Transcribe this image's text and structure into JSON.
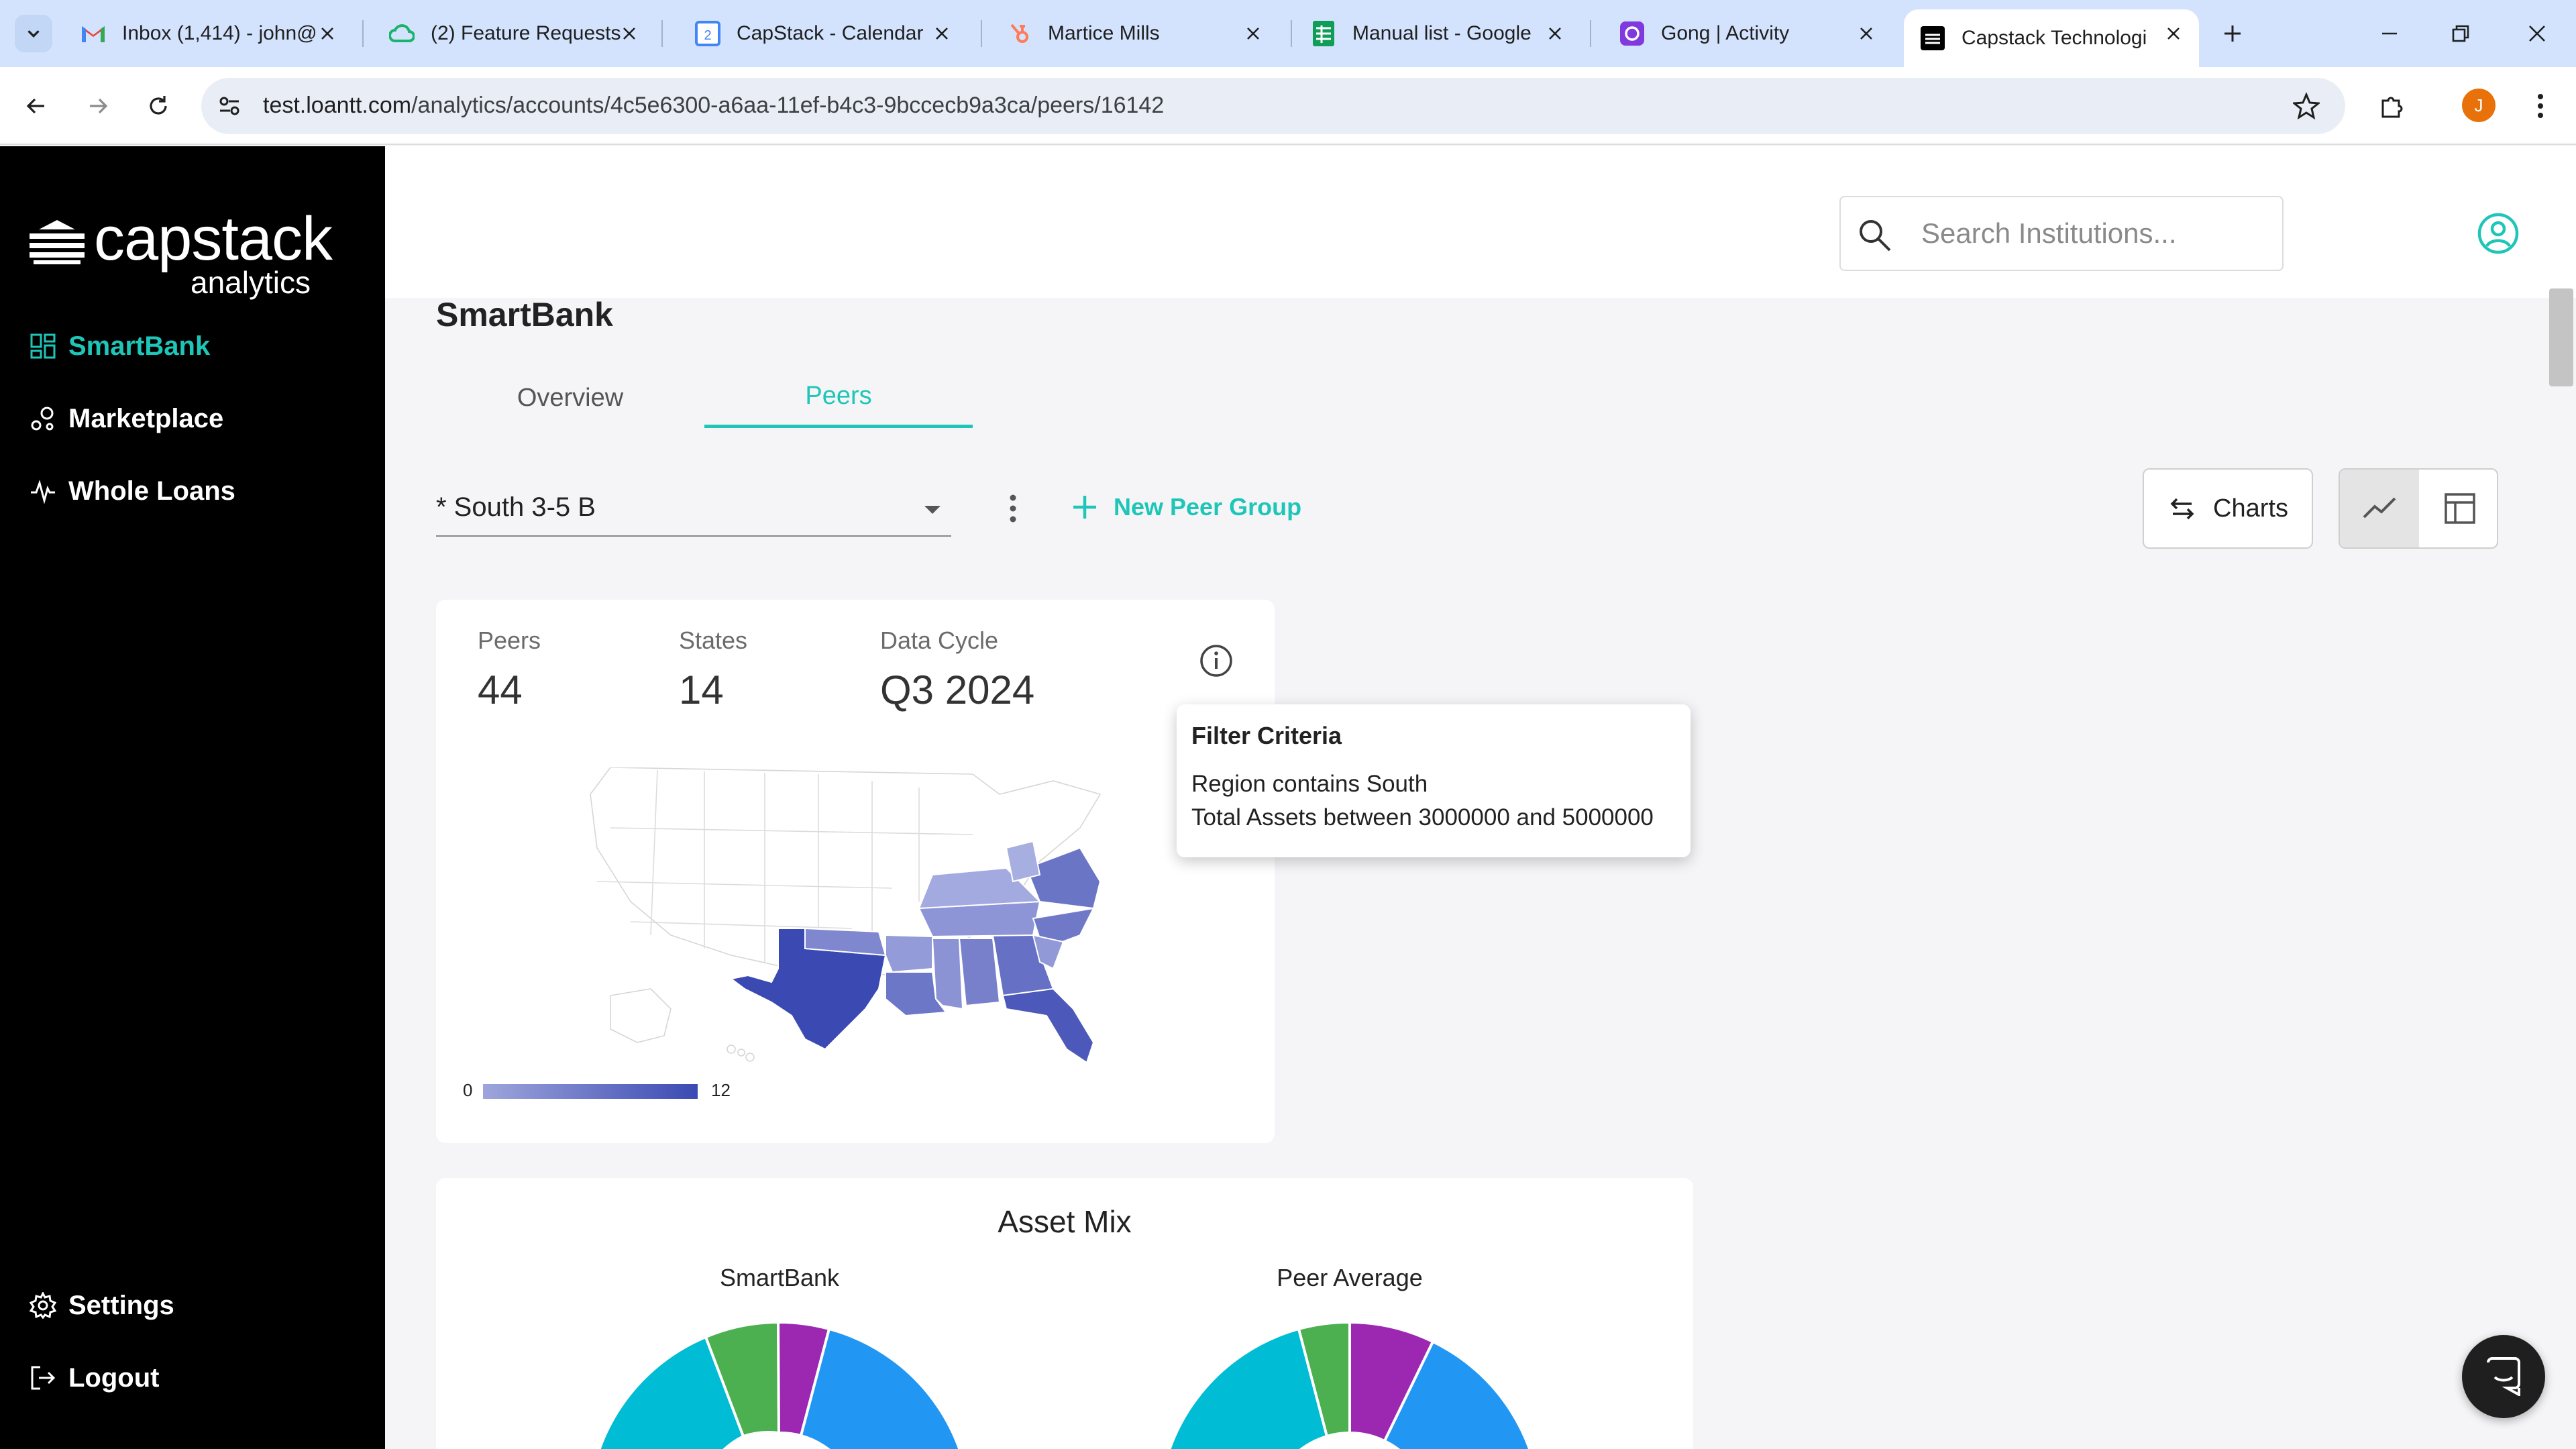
{
  "browser": {
    "tabs": [
      {
        "label": "Inbox (1,414) - john@",
        "icon": "gmail-icon"
      },
      {
        "label": "(2) Feature Requests",
        "icon": "cloud-icon"
      },
      {
        "label": "CapStack - Calendar",
        "icon": "calendar-icon"
      },
      {
        "label": "Martice Mills",
        "icon": "hubspot-icon"
      },
      {
        "label": "Manual list - Google",
        "icon": "sheets-icon"
      },
      {
        "label": "Gong | Activity",
        "icon": "gong-icon"
      },
      {
        "label": "Capstack Technologi",
        "icon": "capstack-icon",
        "active": true
      }
    ],
    "url_host": "test.loantt.com",
    "url_path": "/analytics/accounts/4c5e6300-a6aa-11ef-b4c3-9bccecb9a3ca/peers/16142",
    "profile_initial": "J"
  },
  "sidebar": {
    "logo_word1": "capstack",
    "logo_word2": "analytics",
    "items": [
      {
        "label": "SmartBank",
        "icon": "dashboard-icon",
        "active": true
      },
      {
        "label": "Marketplace",
        "icon": "marketplace-icon"
      },
      {
        "label": "Whole Loans",
        "icon": "pulse-icon"
      }
    ],
    "bottom": [
      {
        "label": "Settings",
        "icon": "gear-icon"
      },
      {
        "label": "Logout",
        "icon": "logout-icon"
      }
    ]
  },
  "header": {
    "search_placeholder": "Search Institutions..."
  },
  "main": {
    "title": "SmartBank",
    "tabs": [
      {
        "label": "Overview"
      },
      {
        "label": "Peers",
        "active": true
      }
    ],
    "peer_group": "* South 3-5 B",
    "new_peer_group": "New Peer Group",
    "charts_button": "Charts"
  },
  "stats": {
    "peers_label": "Peers",
    "peers_value": "44",
    "states_label": "States",
    "states_value": "14",
    "cycle_label": "Data Cycle",
    "cycle_value": "Q3 2024",
    "legend_min": "0",
    "legend_max": "12"
  },
  "tooltip": {
    "title": "Filter Criteria",
    "line1": "Region contains South",
    "line2": "Total Assets between 3000000 and 5000000"
  },
  "asset_mix": {
    "title": "Asset Mix",
    "left_label": "SmartBank",
    "right_label": "Peer Average"
  },
  "colors": {
    "accent": "#1ec6b8",
    "map_dark": "#3b4ab3",
    "map_light": "#9ea5dc",
    "donut_cyan": "#00bcd4",
    "donut_green": "#4caf50",
    "donut_purple": "#9c27b0",
    "donut_blue": "#2196f3"
  }
}
